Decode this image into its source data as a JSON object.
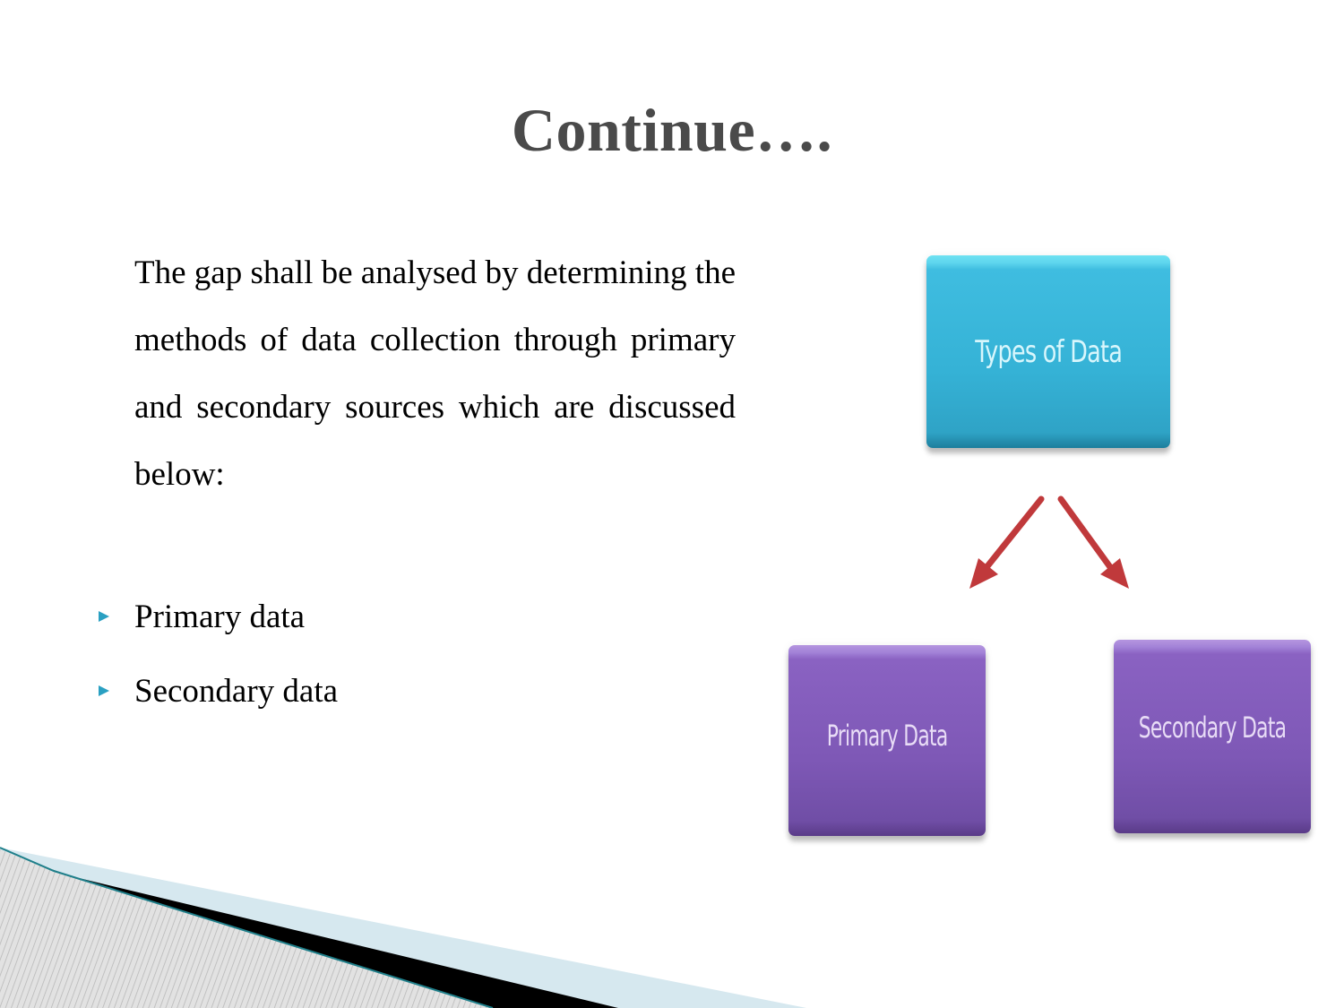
{
  "slide": {
    "title": "Continue….",
    "paragraph": "The gap shall be analysed by determining the methods of data collection through primary and secondary sources which are discussed below:",
    "bullets": [
      {
        "label": "Primary data",
        "icon": "triangle-bullet-icon"
      },
      {
        "label": "Secondary data",
        "icon": "triangle-bullet-icon"
      }
    ],
    "diagram": {
      "root": {
        "label": "Types of Data",
        "color": "#35b2d6"
      },
      "children": [
        {
          "label": "Primary Data",
          "color": "#7e58b6"
        },
        {
          "label": "Secondary Data",
          "color": "#7e58b6"
        }
      ],
      "arrow_color": "#c0393b"
    },
    "colors": {
      "title": "#4a4a4a",
      "bullet_marker": "#2aa0c2",
      "swoosh_dark": "#000000",
      "swoosh_light": "#d6e8ef",
      "swoosh_edge": "#1f7f8a"
    }
  }
}
